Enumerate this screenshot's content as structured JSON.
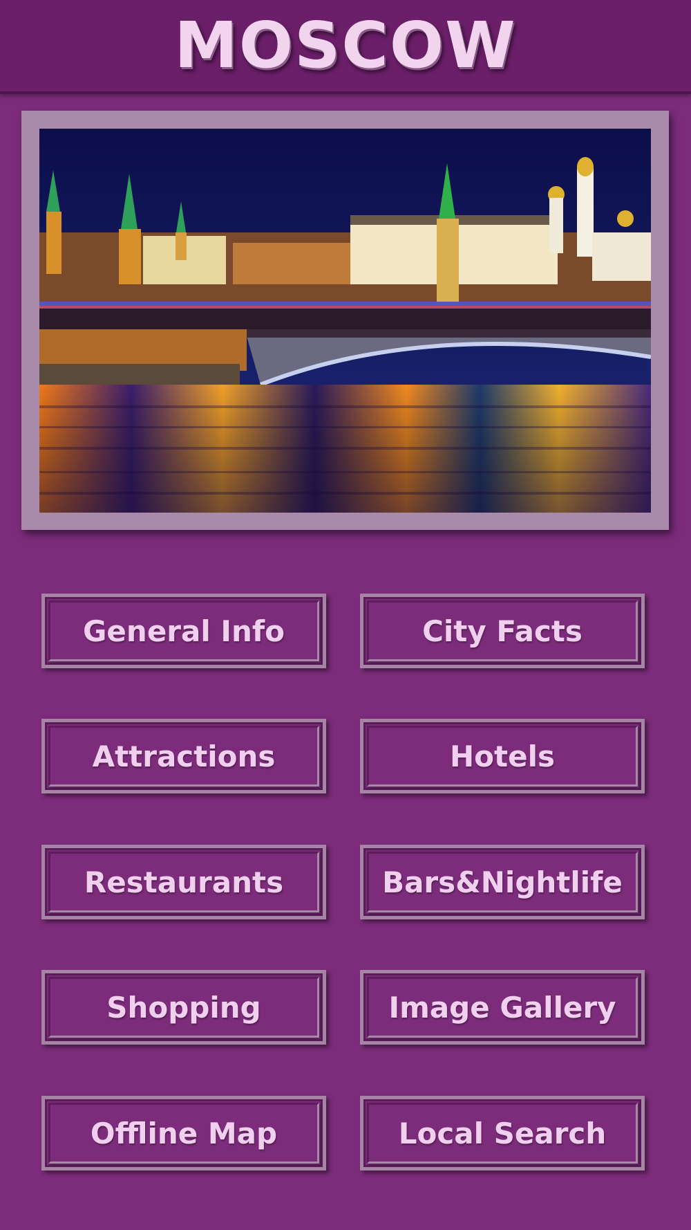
{
  "header": {
    "title": "MOSCOW"
  },
  "hero": {
    "image": "moscow-kremlin-night-river-photo"
  },
  "menu": [
    {
      "label": "General Info"
    },
    {
      "label": "City Facts"
    },
    {
      "label": "Attractions"
    },
    {
      "label": "Hotels"
    },
    {
      "label": "Restaurants"
    },
    {
      "label": "Bars&Nightlife"
    },
    {
      "label": "Shopping"
    },
    {
      "label": "Image Gallery"
    },
    {
      "label": "Offline Map"
    },
    {
      "label": "Local Search"
    }
  ],
  "colors": {
    "background": "#7c2c7a",
    "header": "#6a1f68",
    "title_text": "#f2d4ef",
    "button_border": "#a584a6",
    "button_text": "#f0d0ee"
  }
}
